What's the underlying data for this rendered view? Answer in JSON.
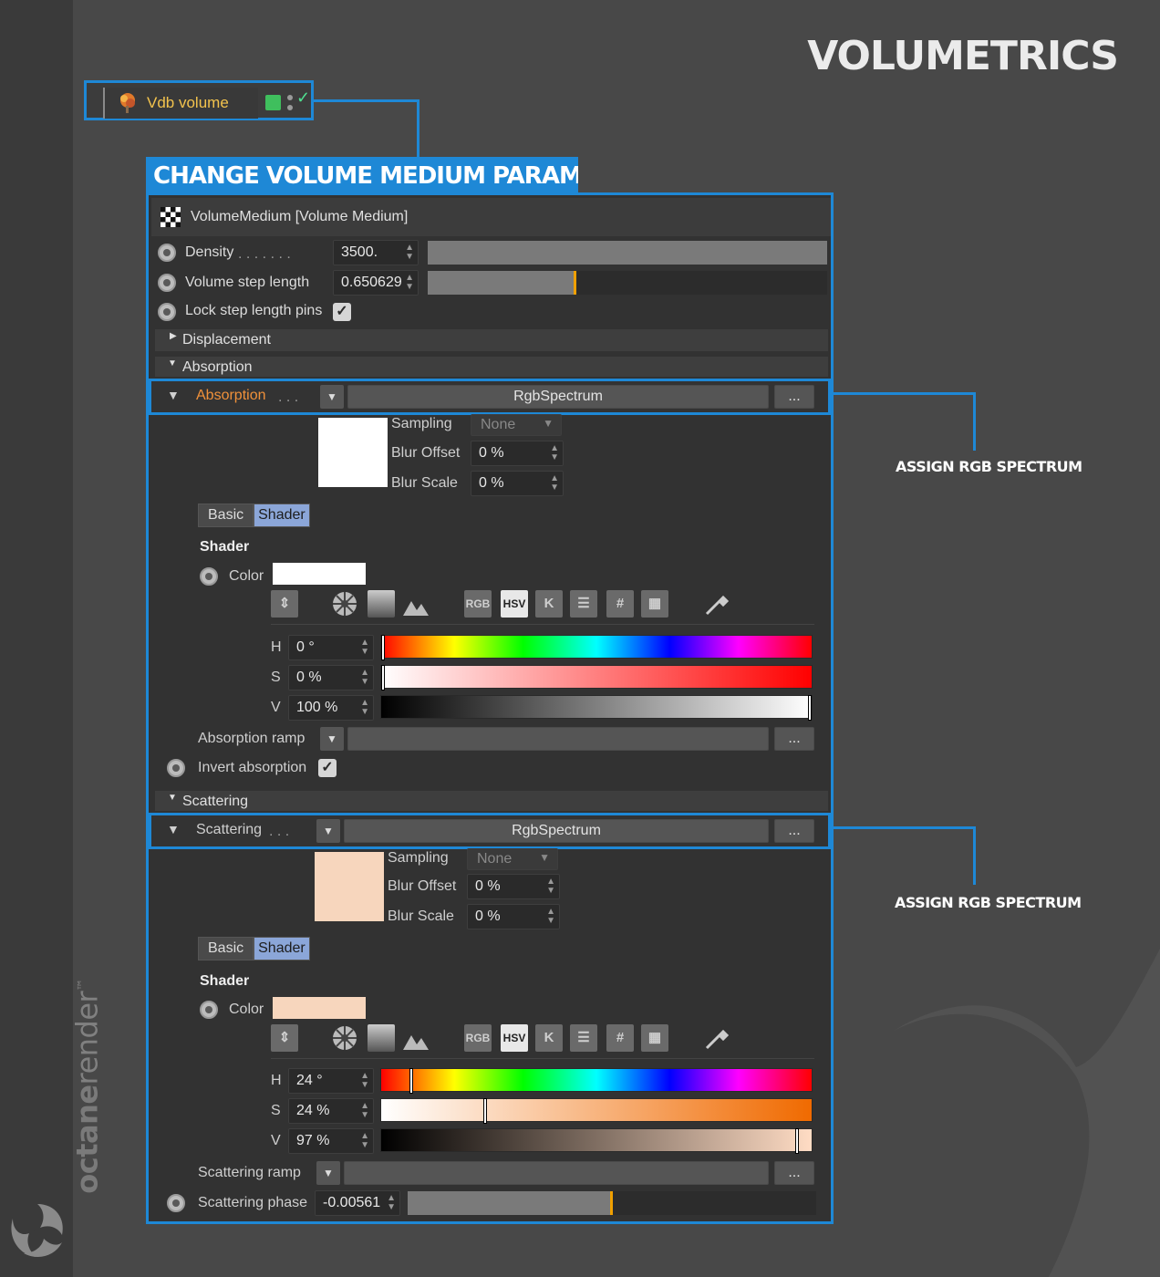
{
  "page_title": "VOLUMETRICS",
  "brand": {
    "name_bold": "octane",
    "name_light": "render",
    "tm": "™"
  },
  "node": {
    "label": "Vdb volume"
  },
  "heading": "CHANGE VOLUME MEDIUM PARAMETERS",
  "panel": {
    "header": "VolumeMedium [Volume Medium]",
    "density": {
      "label": "Density",
      "dots": ". . . . . . .",
      "value": "3500.",
      "fill": 1.0
    },
    "step_length": {
      "label": "Volume step length",
      "value": "0.650629",
      "fill": 0.37
    },
    "lock_pins": {
      "label": "Lock step length pins",
      "checked": true
    },
    "sections": {
      "displacement": "Displacement",
      "absorption": "Absorption",
      "scattering": "Scattering"
    }
  },
  "absorption": {
    "link_label": "Absorption",
    "link_dots": ". . .",
    "shader_type": "RgbSpectrum",
    "more": "...",
    "swatch_color": "#ffffff",
    "sampling_label": "Sampling",
    "sampling_value": "None",
    "blur_offset_label": "Blur Offset",
    "blur_offset_value": "0 %",
    "blur_scale_label": "Blur Scale",
    "blur_scale_value": "0 %",
    "tab_basic": "Basic",
    "tab_shader": "Shader",
    "shader_heading": "Shader",
    "color_label": "Color",
    "h_label": "H",
    "h_value": "0 °",
    "h_level": 0.0,
    "s_label": "S",
    "s_value": "0 %",
    "s_level": 0.0,
    "v_label": "V",
    "v_value": "100 %",
    "v_level": 1.0,
    "ramp_label": "Absorption ramp",
    "invert_label": "Invert absorption",
    "invert_checked": true
  },
  "scattering": {
    "link_label": "Scattering",
    "link_dots": ". . .",
    "shader_type": "RgbSpectrum",
    "more": "...",
    "swatch_color": "#f7d6bd",
    "sampling_label": "Sampling",
    "sampling_value": "None",
    "blur_offset_label": "Blur Offset",
    "blur_offset_value": "0 %",
    "blur_scale_label": "Blur Scale",
    "blur_scale_value": "0 %",
    "tab_basic": "Basic",
    "tab_shader": "Shader",
    "shader_heading": "Shader",
    "color_label": "Color",
    "h_label": "H",
    "h_value": "24 °",
    "h_level": 0.067,
    "s_label": "S",
    "s_value": "24 %",
    "s_level": 0.24,
    "v_label": "V",
    "v_value": "97 %",
    "v_level": 0.97,
    "ramp_label": "Scattering ramp",
    "phase_label": "Scattering phase",
    "phase_value": "-0.00561",
    "phase_fill": 0.5
  },
  "color_tools": {
    "rgb": "RGB",
    "hsv": "HSV",
    "k": "K",
    "hash": "#"
  },
  "annotations": {
    "absorption": "ASSIGN RGB SPECTRUM",
    "scattering": "ASSIGN RGB SPECTRUM"
  },
  "colors": {
    "accent": "#1e88d6",
    "absorption_label": "#f0913a",
    "node_label": "#f3c34d",
    "slider_marker": "#f0a000"
  }
}
